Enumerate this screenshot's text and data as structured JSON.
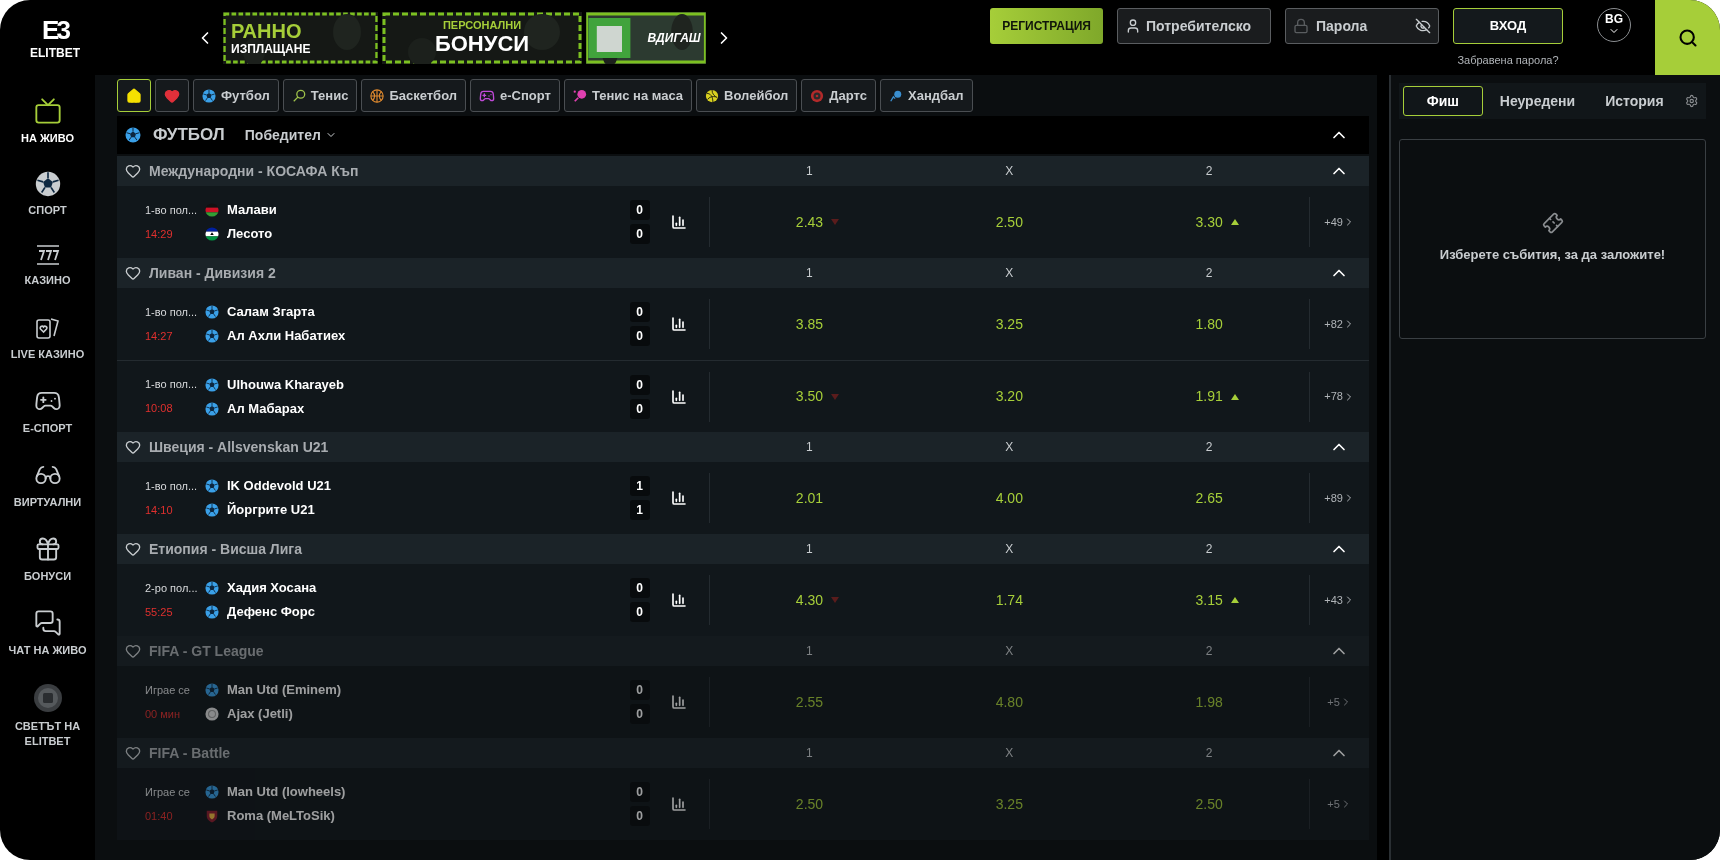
{
  "brand": {
    "logo": "E3",
    "name": "ELITBET"
  },
  "banners": [
    {
      "line1": "РАННО",
      "line2": "ИЗПЛАЩАНЕ"
    },
    {
      "line1": "ПЕРСОНАЛНИ",
      "line2": "БОНУСИ"
    },
    {
      "line1": "ВДИГАШ"
    }
  ],
  "auth": {
    "register": "РЕГИСТРАЦИЯ",
    "username_placeholder": "Потребителско",
    "password_placeholder": "Парола",
    "login": "ВХОД",
    "forgot": "Забравена парола?",
    "language": "BG"
  },
  "sidebar": {
    "items": [
      {
        "label": "НА ЖИВО",
        "kind": "live",
        "selected": true
      },
      {
        "label": "СПОРТ",
        "kind": "ball",
        "selected": false
      },
      {
        "label": "КАЗИНО",
        "kind": "slots",
        "selected": false
      },
      {
        "label": "LIVE КАЗИНО",
        "kind": "cards",
        "selected": false
      },
      {
        "label": "E-СПОРТ",
        "kind": "gamepad",
        "selected": false
      },
      {
        "label": "ВИРТУАЛНИ",
        "kind": "vr",
        "selected": false
      },
      {
        "label": "БОНУСИ",
        "kind": "gift",
        "selected": false
      },
      {
        "label": "ЧАТ НА ЖИВО",
        "kind": "chat",
        "selected": false
      },
      {
        "label": "СВЕТЪТ НА ELITBET",
        "kind": "coin",
        "selected": false
      }
    ]
  },
  "sport_tabs": [
    {
      "kind": "home",
      "selected": true
    },
    {
      "kind": "heart",
      "selected": false
    },
    {
      "kind": "football",
      "label": "Футбол",
      "selected": false
    },
    {
      "kind": "tennis",
      "label": "Тенис",
      "selected": false
    },
    {
      "kind": "basketball",
      "label": "Баскетбол",
      "selected": false
    },
    {
      "kind": "esport",
      "label": "e-Спорт",
      "selected": false
    },
    {
      "kind": "pingpong",
      "label": "Тенис на маса",
      "selected": false
    },
    {
      "kind": "volleyball",
      "label": "Волейбол",
      "selected": false
    },
    {
      "kind": "darts",
      "label": "Дартс",
      "selected": false
    },
    {
      "kind": "handball",
      "label": "Хандбал",
      "selected": false
    }
  ],
  "section": {
    "title": "ФУТБОЛ",
    "market": "Победител"
  },
  "leagues": [
    {
      "name": "Международни - КОСАФА Къп",
      "dimmed": false,
      "columns": [
        "1",
        "X",
        "2"
      ],
      "matches": [
        {
          "period": "1-во пол...",
          "clock": "14:29",
          "home": {
            "name": "Малави",
            "kind": "flag-red",
            "score": "0"
          },
          "away": {
            "name": "Лесото",
            "kind": "flag-blue",
            "score": "0"
          },
          "odds": [
            {
              "value": "2.43",
              "up": false,
              "down": true
            },
            {
              "value": "2.50",
              "up": false,
              "down": false
            },
            {
              "value": "3.30",
              "up": true,
              "down": false
            }
          ],
          "more": "+49"
        }
      ]
    },
    {
      "name": "Ливан - Дивизия 2",
      "dimmed": false,
      "columns": [
        "1",
        "X",
        "2"
      ],
      "matches": [
        {
          "period": "1-во пол...",
          "clock": "14:27",
          "home": {
            "name": "Салам Згарта",
            "kind": "ball",
            "score": "0"
          },
          "away": {
            "name": "Ал Ахли Набатиех",
            "kind": "ball",
            "score": "0"
          },
          "odds": [
            {
              "value": "3.85",
              "up": false,
              "down": false
            },
            {
              "value": "3.25",
              "up": false,
              "down": false
            },
            {
              "value": "1.80",
              "up": false,
              "down": false
            }
          ],
          "more": "+82"
        },
        {
          "period": "1-во пол...",
          "clock": "10:08",
          "home": {
            "name": "Ulhouwa Kharayeb",
            "kind": "ball",
            "score": "0"
          },
          "away": {
            "name": "Ал Мабарах",
            "kind": "ball",
            "score": "0"
          },
          "odds": [
            {
              "value": "3.50",
              "up": false,
              "down": true
            },
            {
              "value": "3.20",
              "up": false,
              "down": false
            },
            {
              "value": "1.91",
              "up": true,
              "down": false
            }
          ],
          "more": "+78"
        }
      ]
    },
    {
      "name": "Швеция - Allsvenskan U21",
      "dimmed": false,
      "columns": [
        "1",
        "X",
        "2"
      ],
      "matches": [
        {
          "period": "1-во пол...",
          "clock": "14:10",
          "home": {
            "name": "IK Oddevold U21",
            "kind": "ball",
            "score": "1"
          },
          "away": {
            "name": "Йоргрите U21",
            "kind": "ball",
            "score": "1"
          },
          "odds": [
            {
              "value": "2.01",
              "up": false,
              "down": false
            },
            {
              "value": "4.00",
              "up": false,
              "down": false
            },
            {
              "value": "2.65",
              "up": false,
              "down": false
            }
          ],
          "more": "+89"
        }
      ]
    },
    {
      "name": "Етиопия - Висша Лига",
      "dimmed": false,
      "columns": [
        "1",
        "X",
        "2"
      ],
      "matches": [
        {
          "period": "2-ро пол...",
          "clock": "55:25",
          "home": {
            "name": "Хадия Хосана",
            "kind": "ball",
            "score": "0"
          },
          "away": {
            "name": "Дефенс Форс",
            "kind": "ball",
            "score": "0"
          },
          "odds": [
            {
              "value": "4.30",
              "up": false,
              "down": true
            },
            {
              "value": "1.74",
              "up": false,
              "down": false
            },
            {
              "value": "3.15",
              "up": true,
              "down": false
            }
          ],
          "more": "+43"
        }
      ]
    },
    {
      "name": "FIFA - GT League",
      "dimmed": true,
      "columns": [
        "1",
        "X",
        "2"
      ],
      "matches": [
        {
          "period": "Играе се",
          "clock": "00 мин",
          "home": {
            "name": "Man Utd (Eminem)",
            "kind": "ball",
            "score": "0"
          },
          "away": {
            "name": "Ajax (Jetli)",
            "kind": "crest-white",
            "score": "0"
          },
          "odds": [
            {
              "value": "2.55",
              "up": false,
              "down": false
            },
            {
              "value": "4.80",
              "up": false,
              "down": false
            },
            {
              "value": "1.98",
              "up": false,
              "down": false
            }
          ],
          "more": "+5"
        }
      ]
    },
    {
      "name": "FIFA - Battle",
      "dimmed": true,
      "columns": [
        "1",
        "X",
        "2"
      ],
      "matches": [
        {
          "period": "Играе се",
          "clock": "01:40",
          "home": {
            "name": "Man Utd (lowheels)",
            "kind": "ball",
            "score": "0"
          },
          "away": {
            "name": "Roma (MeLToSik)",
            "kind": "crest-red",
            "score": "0"
          },
          "odds": [
            {
              "value": "2.50",
              "up": false,
              "down": false
            },
            {
              "value": "3.25",
              "up": false,
              "down": false
            },
            {
              "value": "2.50",
              "up": false,
              "down": false
            }
          ],
          "more": "+5"
        }
      ]
    }
  ],
  "betslip": {
    "tabs": [
      {
        "label": "Фиш",
        "selected": true
      },
      {
        "label": "Неуредени",
        "selected": false
      },
      {
        "label": "История",
        "selected": false
      }
    ],
    "empty_message": "Изберете събития, за да заложите!"
  }
}
